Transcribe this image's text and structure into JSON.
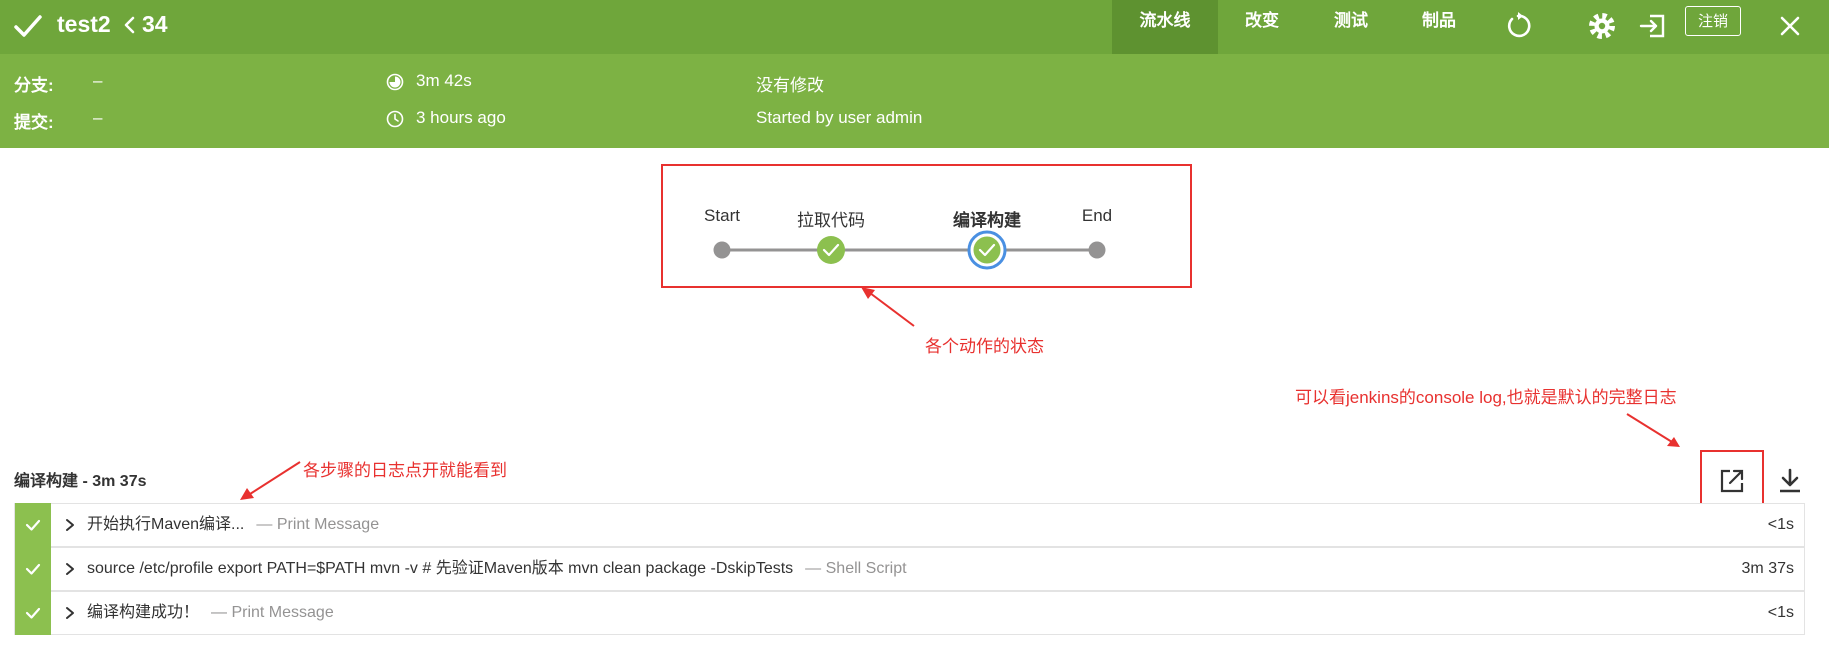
{
  "header": {
    "job_name": "test2",
    "run_number": "34",
    "tabs": [
      {
        "label": "流水线",
        "active": true
      },
      {
        "label": "改变",
        "active": false
      },
      {
        "label": "测试",
        "active": false
      },
      {
        "label": "制品",
        "active": false
      }
    ],
    "logout_label": "注销",
    "icons": [
      "check-icon",
      "chevron-left-icon",
      "replay-icon",
      "gear-icon",
      "exit-icon",
      "close-icon"
    ],
    "colors": {
      "header_bg": "#6fa63b",
      "info_bg": "#7db244",
      "success": "#8cc04f",
      "selected_ring": "#4a90e2"
    }
  },
  "info": {
    "branch_label": "分支:",
    "branch_value": "–",
    "commit_label": "提交:",
    "commit_value": "–",
    "duration": "3m 42s",
    "time_ago": "3 hours ago",
    "changes": "没有修改",
    "started_by": "Started by user admin"
  },
  "pipeline": {
    "stages": [
      {
        "label": "Start",
        "status": "none"
      },
      {
        "label": "拉取代码",
        "status": "success"
      },
      {
        "label": "编译构建",
        "status": "success",
        "selected": true
      },
      {
        "label": "End",
        "status": "none"
      }
    ]
  },
  "steps": {
    "title": "编译构建 - 3m 37s",
    "rows": [
      {
        "text": "开始执行Maven编译...",
        "type": "— Print Message",
        "duration": "<1s",
        "status": "success"
      },
      {
        "text": "source /etc/profile export PATH=$PATH mvn -v # 先验证Maven版本 mvn clean package -DskipTests",
        "type": "— Shell Script",
        "duration": "3m 37s",
        "status": "success"
      },
      {
        "text": "编译构建成功！",
        "type": "— Print Message",
        "duration": "<1s",
        "status": "success"
      }
    ],
    "actions": [
      "external-link-icon",
      "download-icon"
    ]
  },
  "annotations": {
    "stage_status": "各个动作的状态",
    "step_logs": "各步骤的日志点开就能看到",
    "console_log": "可以看jenkins的console log,也就是默认的完整日志",
    "color": "#e8312f"
  }
}
